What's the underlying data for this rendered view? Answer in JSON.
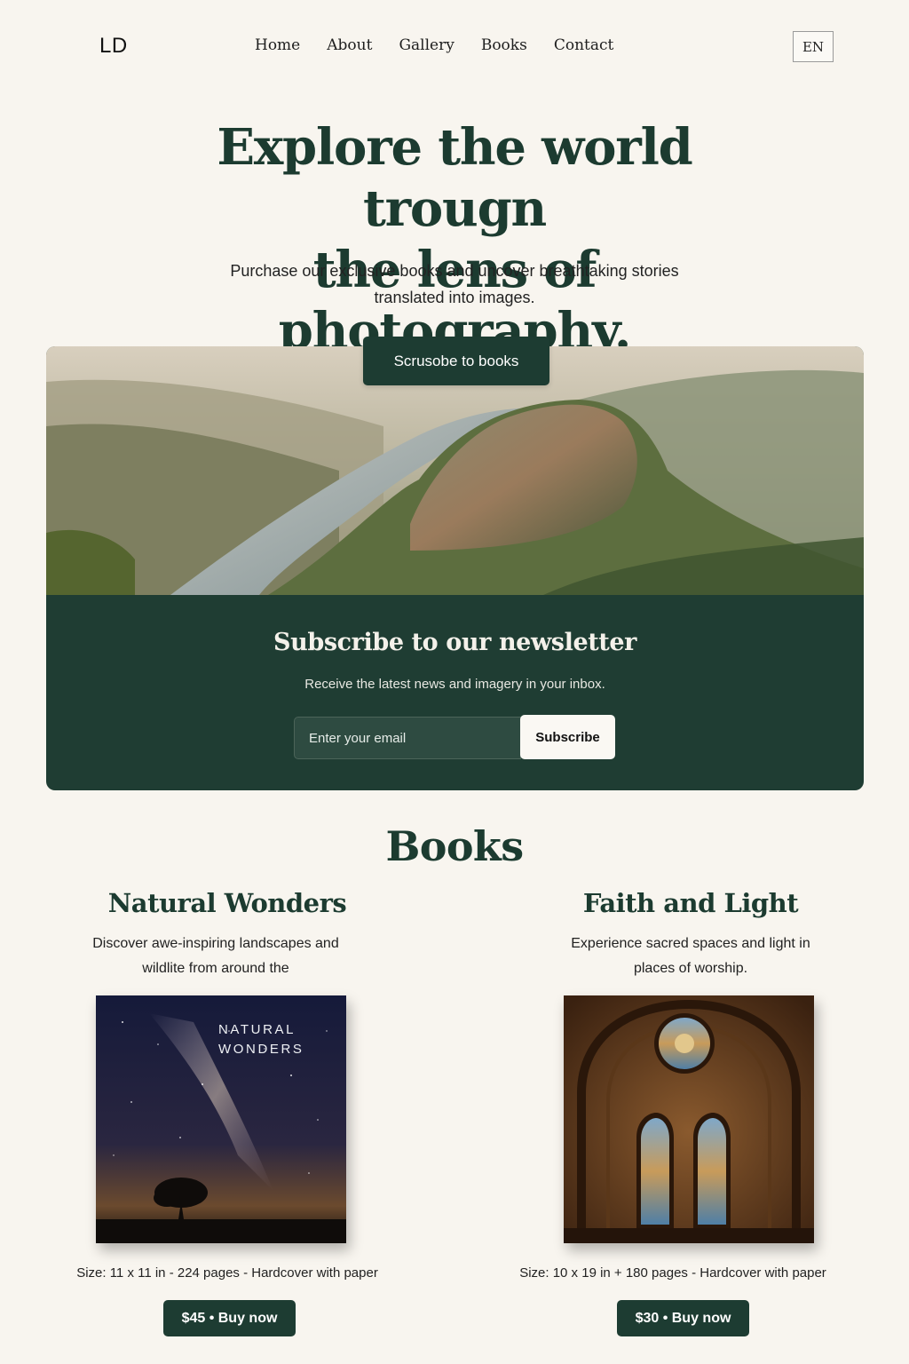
{
  "header": {
    "logo": "LD",
    "nav": [
      "Home",
      "About",
      "Gallery",
      "Books",
      "Contact"
    ],
    "language": "EN"
  },
  "hero": {
    "title_line1": "Explore the world trougn",
    "title_line2": "the lens of photography.",
    "subtitle_line1": "Purchase our exclusive books and uncover breathtaking stories",
    "subtitle_line2": "translated into images.",
    "cta_label": "Scrusobe to books"
  },
  "newsletter": {
    "title": "Subscribe to our newsletter",
    "subtitle": "Receive the latest news and imagery in your inbox.",
    "email_placeholder": "Enter your email",
    "button_label": "Subscribe"
  },
  "books": {
    "heading": "Books",
    "items": [
      {
        "title": "Natural Wonders",
        "description_line1": "Discover awe-inspiring landscapes and",
        "description_line2": "wildlite from around the",
        "cover_title_line1": "NATURAL",
        "cover_title_line2": "WONDERS",
        "meta": "Size: 11 x 11 in - 224 pages - Hardcover with paper",
        "buy_label": "$45 • Buy now"
      },
      {
        "title": "Faith and Light",
        "description_line1": "Experience sacred spaces and light in",
        "description_line2": "places of worship.",
        "meta": "Size: 10 x 19 in + 180 pages - Hardcover with paper",
        "buy_label": "$30 • Buy now"
      }
    ]
  },
  "colors": {
    "background": "#f8f5ef",
    "brand_green": "#1d3c32",
    "heading_green": "#1c3b30"
  }
}
